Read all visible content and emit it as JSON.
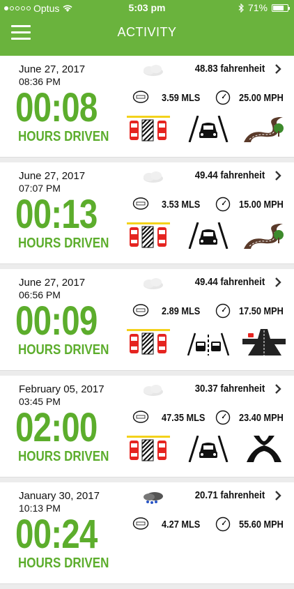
{
  "status_bar": {
    "carrier": "Optus",
    "time": "5:03 pm",
    "battery": "71%"
  },
  "header": {
    "title": "ACTIVITY"
  },
  "colors": {
    "brand_green": "#6ab33d",
    "duration_green": "#5cad2c"
  },
  "trips": [
    {
      "date": "June 27, 2017",
      "time": "08:36 PM",
      "duration": "00:08",
      "duration_label": "HOURS DRIVEN",
      "weather": "cloudy",
      "temperature": "48.83 fahrenheit",
      "distance": "3.59 MLS",
      "speed": "25.00 MPH",
      "icons": [
        "parking-icon",
        "lane-icon",
        "winding-road-icon"
      ]
    },
    {
      "date": "June 27, 2017",
      "time": "07:07 PM",
      "duration": "00:13",
      "duration_label": "HOURS DRIVEN",
      "weather": "cloudy",
      "temperature": "49.44 fahrenheit",
      "distance": "3.53 MLS",
      "speed": "15.00 MPH",
      "icons": [
        "parking-icon",
        "lane-icon",
        "winding-road-icon"
      ]
    },
    {
      "date": "June 27, 2017",
      "time": "06:56 PM",
      "duration": "00:09",
      "duration_label": "HOURS DRIVEN",
      "weather": "cloudy",
      "temperature": "49.44 fahrenheit",
      "distance": "2.89 MLS",
      "speed": "17.50 MPH",
      "icons": [
        "parking-icon",
        "overtake-icon",
        "intersection-icon"
      ]
    },
    {
      "date": "February 05, 2017",
      "time": "03:45 PM",
      "duration": "02:00",
      "duration_label": "HOURS DRIVEN",
      "weather": "cloudy",
      "temperature": "30.37 fahrenheit",
      "distance": "47.35 MLS",
      "speed": "23.40 MPH",
      "icons": [
        "parking-icon",
        "lane-icon",
        "highway-icon"
      ]
    },
    {
      "date": "January 30, 2017",
      "time": "10:13 PM",
      "duration": "00:24",
      "duration_label": "HOURS DRIVEN",
      "weather": "rain",
      "temperature": "20.71 fahrenheit",
      "distance": "4.27 MLS",
      "speed": "55.60 MPH",
      "icons": []
    }
  ]
}
